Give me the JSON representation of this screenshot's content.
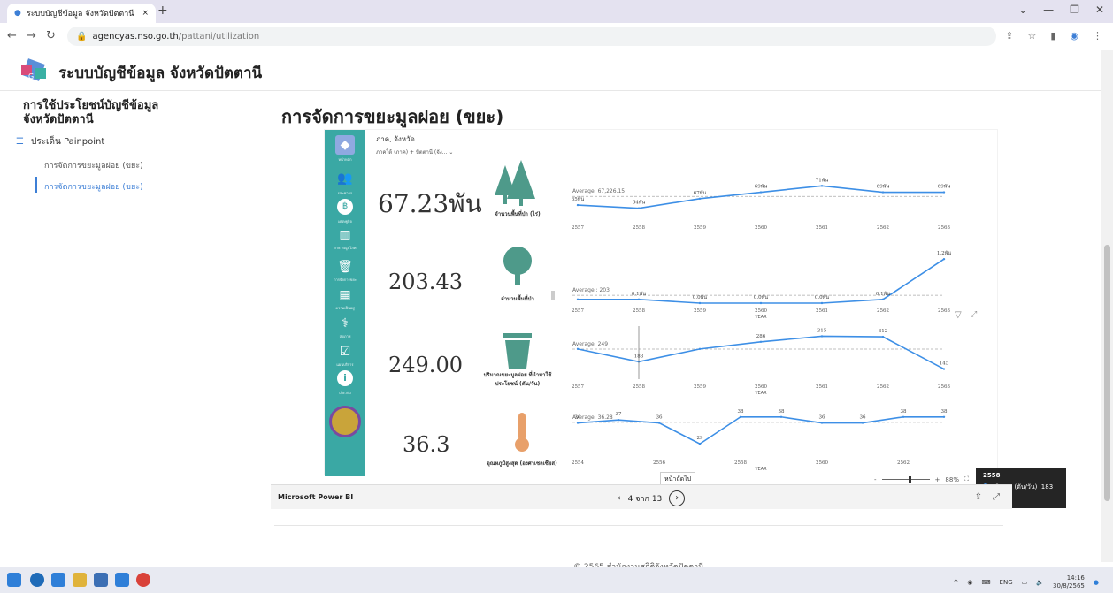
{
  "browser": {
    "tab_title": "ระบบบัญชีข้อมูล จังหวัดปัตตานี",
    "tab_close": "×",
    "new_tab": "+",
    "url_host": "agencyas.nso.go.th",
    "url_path": "/pattani/utilization"
  },
  "site": {
    "title": "ระบบบัญชีข้อมูล จังหวัดปัตตานี"
  },
  "sidebar": {
    "heading": "การใช้ประโยชน์บัญชีข้อมูล จังหวัดปัตตานี",
    "section": "ประเด็น Painpoint",
    "items": [
      {
        "label": "การจัดการขยะมูลฝอย (ขยะ)"
      },
      {
        "label": "การจัดการขยะมูลฝอย (ขยะ)"
      }
    ]
  },
  "main": {
    "page_title": "การจัดการขยะมูลฝอย (ขยะ)"
  },
  "report": {
    "filter_label": "ภาค, จังหวัด",
    "filter_value": "ภาคใต้ (ภาค) + ปัตตานี (จัง...",
    "nav": [
      {
        "caption": "หน้าหลัก"
      },
      {
        "caption": "ประชากร"
      },
      {
        "caption": "เศรษฐกิจ"
      },
      {
        "caption": "สาธารณูปโภค"
      },
      {
        "caption": "การจัดการขยะ"
      },
      {
        "caption": "ความเป็นอยู่"
      },
      {
        "caption": "สุขภาพ"
      },
      {
        "caption": "แผนบริการ"
      },
      {
        "caption": "เกี่ยวกับ"
      }
    ],
    "kpis": [
      {
        "value": "67.23พัน",
        "caption": "จำนวนพื้นที่ป่า (ไร่)"
      },
      {
        "value": "203.43",
        "caption": "จำนวนพื้นที่ป่า"
      },
      {
        "value": "249.00",
        "caption": "ปริมาณขยะมูลฝอย ที่นำมาใช้ประโยชน์ (ตัน/วัน)"
      },
      {
        "value": "36.3",
        "caption": "อุณหภูมิสูงสุด (องศาเซลเซียส)"
      }
    ],
    "tooltip": {
      "year": "2558",
      "label": "ปริมาณ (ตัน/วัน)",
      "value": "183"
    },
    "axis_word": "YEAR",
    "zoom": "88%",
    "next_tooltip": "หน้าถัดไป"
  },
  "chart_data": [
    {
      "type": "line",
      "x": [
        "2557",
        "2558",
        "2559",
        "2560",
        "2561",
        "2562",
        "2563"
      ],
      "series": [
        {
          "values": [
            65,
            64,
            67,
            69,
            71,
            69,
            69
          ]
        }
      ],
      "data_labels": [
        "65พัน",
        "64พัน",
        "67พัน",
        "69พัน",
        "71พัน",
        "69พัน",
        "69พัน"
      ],
      "average_label": "Average: 67,226.15",
      "ylim": [
        62,
        73
      ]
    },
    {
      "type": "line",
      "x": [
        "2557",
        "2558",
        "2559",
        "2560",
        "2561",
        "2562",
        "2563"
      ],
      "series": [
        {
          "values": [
            100,
            100,
            0,
            0,
            0,
            100,
            1200
          ]
        }
      ],
      "data_labels": [
        "",
        "0.1พัน",
        "0.0พัน",
        "0.0พัน",
        "0.0พัน",
        "0.1พัน",
        "1.2พัน"
      ],
      "average_label": "Average : 203",
      "xlabel": "YEAR",
      "ylim": [
        0,
        1300
      ]
    },
    {
      "type": "line",
      "x": [
        "2557",
        "2558",
        "2559",
        "2560",
        "2561",
        "2562",
        "2563"
      ],
      "series": [
        {
          "values": [
            249,
            183,
            249,
            286,
            315,
            312,
            145
          ]
        }
      ],
      "data_labels": [
        "",
        "183",
        "",
        "286",
        "315",
        "312",
        "145"
      ],
      "average_label": "Average: 249",
      "xlabel": "YEAR",
      "ylim": [
        120,
        340
      ]
    },
    {
      "type": "line",
      "x": [
        "2554",
        "2555",
        "2556",
        "2557",
        "2558",
        "2559",
        "2560",
        "2561",
        "2562",
        "2563"
      ],
      "series": [
        {
          "values": [
            36,
            37,
            36,
            29,
            38,
            38,
            36,
            36,
            38,
            38
          ]
        }
      ],
      "data_labels": [
        "36",
        "37",
        "36",
        "29",
        "38",
        "38",
        "36",
        "36",
        "38",
        "38"
      ],
      "tick_labels": [
        "2554",
        "2556",
        "2558",
        "2560",
        "2562"
      ],
      "average_label": "Average: 36.28",
      "xlabel": "YEAR",
      "ylim": [
        27,
        40
      ]
    }
  ],
  "footer_bar": {
    "brand": "Microsoft Power BI",
    "page": "4 จาก 13"
  },
  "page_footer": {
    "copyright": "© 2565 สำนักงานสถิติจังหวัดปัตตานี"
  },
  "taskbar": {
    "lang": "ENG",
    "time": "14:16",
    "date": "30/8/2565"
  }
}
